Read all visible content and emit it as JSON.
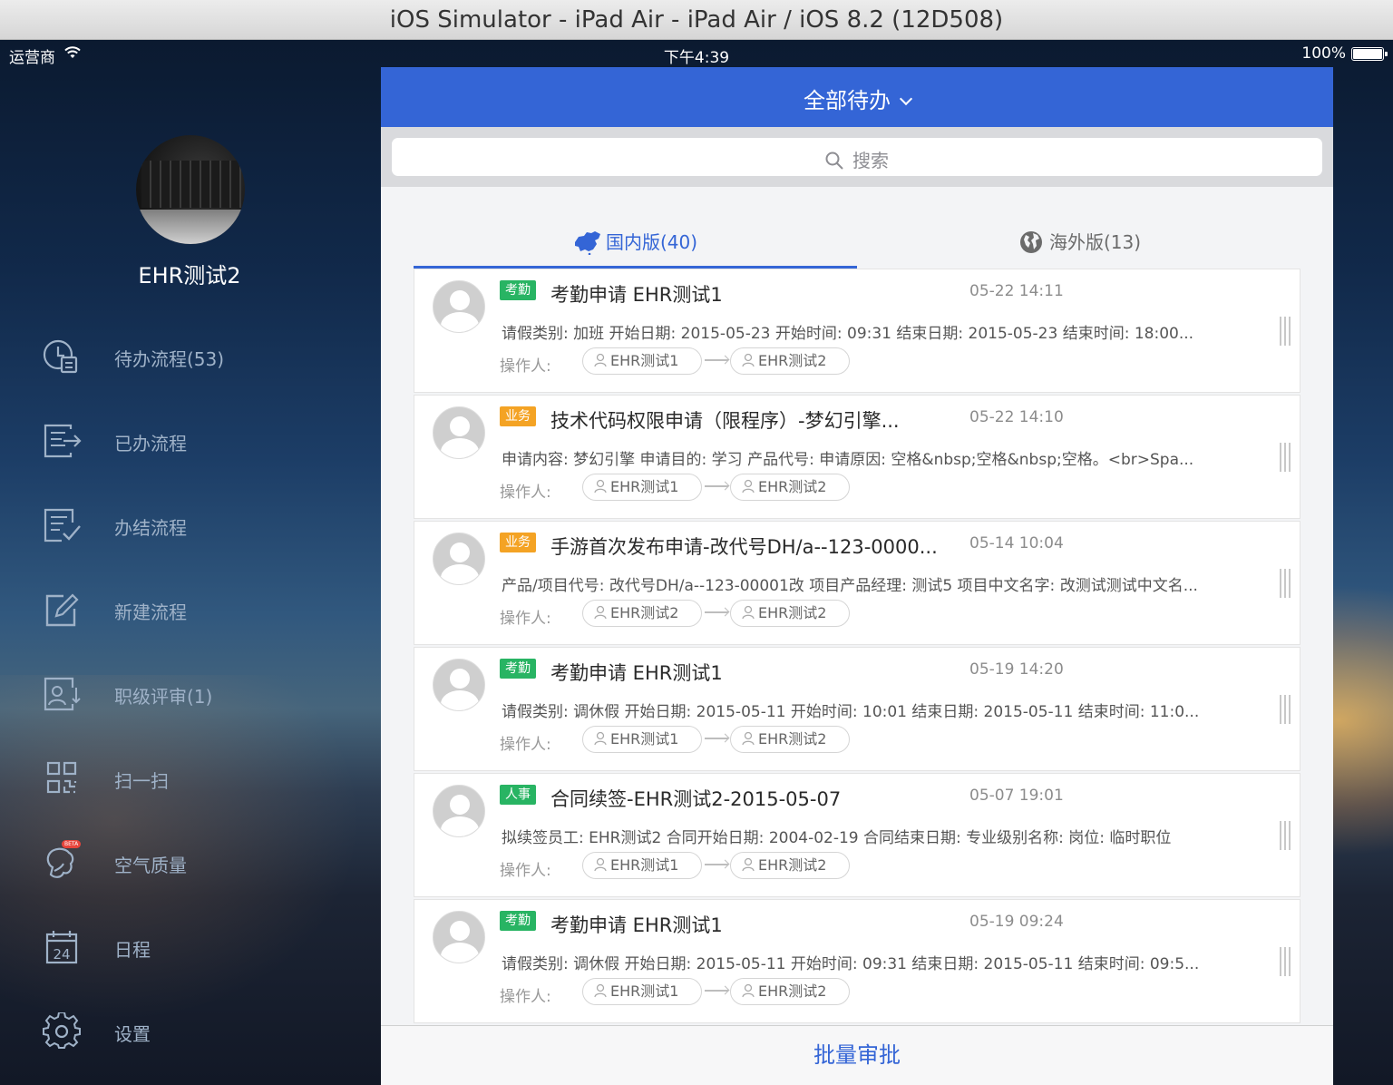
{
  "window": {
    "title": "iOS Simulator - iPad Air - iPad Air / iOS 8.2 (12D508)"
  },
  "status_bar": {
    "carrier": "运营商",
    "time": "下午4:39",
    "battery": "100%"
  },
  "sidebar": {
    "user_name": "EHR测试2",
    "items": [
      {
        "label": "待办流程(53)",
        "icon": "clock-doc-icon"
      },
      {
        "label": "已办流程",
        "icon": "doc-arrow-icon"
      },
      {
        "label": "办结流程",
        "icon": "doc-check-icon"
      },
      {
        "label": "新建流程",
        "icon": "edit-icon"
      },
      {
        "label": "职级评审(1)",
        "icon": "review-icon"
      },
      {
        "label": "扫一扫",
        "icon": "qr-scan-icon"
      },
      {
        "label": "空气质量",
        "icon": "air-quality-icon",
        "badge": "BETA"
      },
      {
        "label": "日程",
        "icon": "calendar-icon",
        "day": "24"
      },
      {
        "label": "设置",
        "icon": "gear-icon"
      }
    ]
  },
  "header": {
    "title": "全部待办"
  },
  "search": {
    "placeholder": "搜索"
  },
  "tabs": [
    {
      "label": "国内版(40)",
      "icon": "china-map-icon",
      "active": true
    },
    {
      "label": "海外版(13)",
      "icon": "globe-icon",
      "active": false
    }
  ],
  "colors": {
    "accent": "#3465d6",
    "tag_green": "#28b463",
    "tag_orange": "#f4a324"
  },
  "operator_label": "操作人:",
  "items": [
    {
      "tag": "考勤",
      "tag_color": "green",
      "title": "考勤申请 EHR测试1",
      "time": "05-22 14:11",
      "desc": "请假类别: 加班  开始日期: 2015-05-23  开始时间: 09:31  结束日期: 2015-05-23  结束时间: 18:00...",
      "from": "EHR测试1",
      "to": "EHR测试2"
    },
    {
      "tag": "业务",
      "tag_color": "orange",
      "title": "技术代码权限申请（限程序）-梦幻引擎...",
      "time": "05-22 14:10",
      "desc": "申请内容: 梦幻引擎  申请目的: 学习  产品代号:   申请原因: 空格&nbsp;空格&nbsp;空格。<br>Spa...",
      "from": "EHR测试1",
      "to": "EHR测试2"
    },
    {
      "tag": "业务",
      "tag_color": "orange",
      "title": "手游首次发布申请-改代号DH/a--123-0000...",
      "time": "05-14 10:04",
      "desc": "产品/项目代号: 改代号DH/a--123-00001改  项目产品经理: 测试5  项目中文名字: 改测试测试中文名...",
      "from": "EHR测试2",
      "to": "EHR测试2"
    },
    {
      "tag": "考勤",
      "tag_color": "green",
      "title": "考勤申请 EHR测试1",
      "time": "05-19 14:20",
      "desc": "请假类别: 调休假  开始日期: 2015-05-11  开始时间: 10:01  结束日期: 2015-05-11  结束时间: 11:0...",
      "from": "EHR测试1",
      "to": "EHR测试2"
    },
    {
      "tag": "人事",
      "tag_color": "green",
      "title": "合同续签-EHR测试2-2015-05-07",
      "time": "05-07 19:01",
      "desc": "拟续签员工: EHR测试2  合同开始日期: 2004-02-19  合同结束日期:   专业级别名称:   岗位: 临时职位",
      "from": "EHR测试1",
      "to": "EHR测试2"
    },
    {
      "tag": "考勤",
      "tag_color": "green",
      "title": "考勤申请 EHR测试1",
      "time": "05-19 09:24",
      "desc": "请假类别: 调休假  开始日期: 2015-05-11  开始时间: 09:31  结束日期: 2015-05-11  结束时间: 09:5...",
      "from": "EHR测试1",
      "to": "EHR测试2"
    }
  ],
  "bottom": {
    "batch_label": "批量审批"
  }
}
